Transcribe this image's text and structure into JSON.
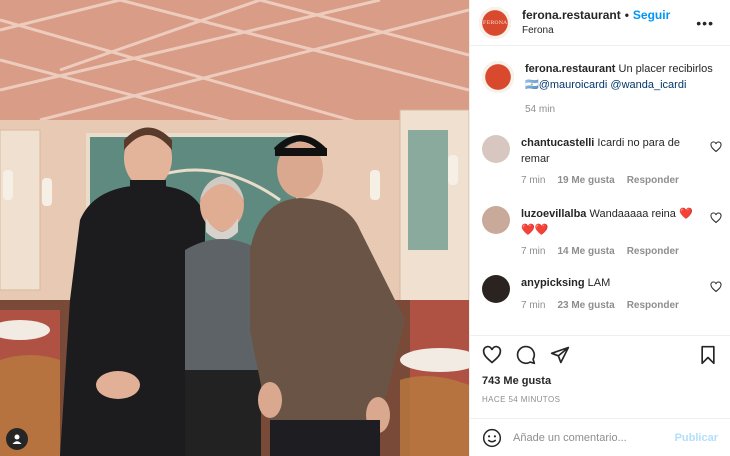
{
  "post": {
    "account": "ferona.restaurant",
    "follow_label": "Seguir",
    "location": "Ferona",
    "avatar_text": "FERONA",
    "more_icon": "more-options-icon"
  },
  "caption": {
    "user": "ferona.restaurant",
    "text": "Un placer recibirlos",
    "flag": "🇦🇷",
    "mention1": "@mauroicardi",
    "mention2": "@wanda_icardi",
    "time": "54 min"
  },
  "comments": [
    {
      "user": "chantucastelli",
      "text": "Icardi no para de remar",
      "time": "7 min",
      "likes": "19 Me gusta",
      "reply": "Responder",
      "avatar_color": "#d7c7c0"
    },
    {
      "user": "luzoevillalba",
      "text": "Wandaaaaa reina",
      "hearts": "❤️❤️❤️",
      "time": "7 min",
      "likes": "14 Me gusta",
      "reply": "Responder",
      "avatar_color": "#c8a99a"
    },
    {
      "user": "anypicksing",
      "text": "LAM",
      "time": "7 min",
      "likes": "23 Me gusta",
      "reply": "Responder",
      "avatar_color": "#2b2320"
    }
  ],
  "footer": {
    "likes": "743 Me gusta",
    "ago": "HACE 54 MINUTOS",
    "add_placeholder": "Añade un comentario...",
    "publish": "Publicar"
  },
  "colors": {
    "link": "#0095f6",
    "mention": "#00376b",
    "muted": "#8e8e8e",
    "publish_disabled": "#b2dffc"
  }
}
